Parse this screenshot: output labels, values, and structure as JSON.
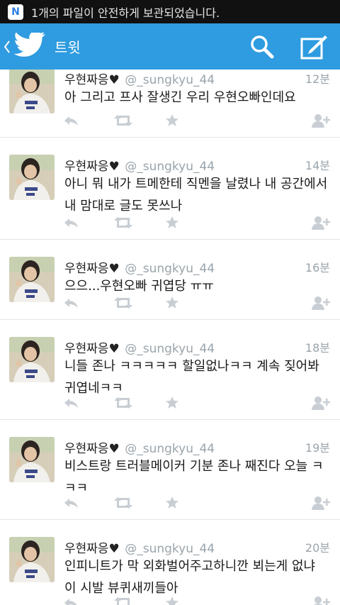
{
  "status_bar": {
    "app_icon_letter": "N",
    "notification_text": "1개의 파일이 안전하게 보관되었습니다."
  },
  "app_bar": {
    "title": "트윗"
  },
  "colors": {
    "app_bar": "#2f9be0",
    "status_bar": "#111111",
    "handle": "#9aa4ab",
    "action_icon": "#c8ced3"
  },
  "tweets": [
    {
      "name": "우현짜응♥",
      "handle": "@_sungkyu_44",
      "time": "12분",
      "text": "아 그리고 프사 잘생긴 우리 우현오빠인데요"
    },
    {
      "name": "우현짜응♥",
      "handle": "@_sungkyu_44",
      "time": "14분",
      "text": "아니 뭐 내가 트메한테 직멘을 날렸나 내 공간에서 내 맘대로 글도 못쓰나"
    },
    {
      "name": "우현짜응♥",
      "handle": "@_sungkyu_44",
      "time": "16분",
      "text": "으으...우현오빠 귀엽당 ㅠㅠ"
    },
    {
      "name": "우현짜응♥",
      "handle": "@_sungkyu_44",
      "time": "18분",
      "text": "니들 존나 ㅋㅋㅋㅋㅋ 할일없나ㅋㅋ 계속 짖어봐 귀엽네ㅋㅋ"
    },
    {
      "name": "우현짜응♥",
      "handle": "@_sungkyu_44",
      "time": "19분",
      "text": "비스트랑 트러블메이커 기분 존나 째진다 오늘 ㅋㅋㅋ"
    },
    {
      "name": "우현짜응♥",
      "handle": "@_sungkyu_44",
      "time": "20분",
      "text": "인피니트가 막 외화벌어주고하니깐 뵈는게 없냐 이 시발 뷰퀴새끼들아"
    }
  ]
}
